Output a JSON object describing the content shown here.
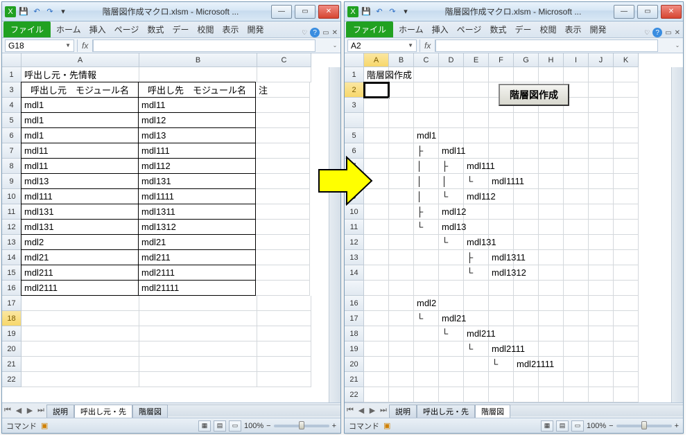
{
  "app_title": "階層図作成マクロ.xlsm - Microsoft ...",
  "ribbon": {
    "file": "ファイル",
    "tabs": [
      "ホーム",
      "挿入",
      "ページ",
      "数式",
      "デー",
      "校閲",
      "表示",
      "開発"
    ]
  },
  "qat": {
    "excel": "X",
    "save": "💾",
    "undo": "↶",
    "redo": "↷",
    "dd": "▾"
  },
  "win_buttons": {
    "min": "—",
    "max": "▭",
    "close": "✕"
  },
  "left": {
    "namebox": "G18",
    "fx": "fx",
    "columns": [
      "A",
      "B",
      "C"
    ],
    "rownums": [
      1,
      3,
      4,
      5,
      6,
      7,
      8,
      9,
      10,
      11,
      12,
      13,
      14,
      15,
      16,
      17,
      18,
      19,
      20,
      21,
      22
    ],
    "title_cell": "呼出し元・先情報",
    "header_src": "呼出し元　モジュール名",
    "header_dst": "呼出し先　モジュール名",
    "note_c": "注",
    "rows": [
      {
        "src": "mdl1",
        "dst": "mdl11"
      },
      {
        "src": "mdl1",
        "dst": "mdl12"
      },
      {
        "src": "mdl1",
        "dst": "mdl13"
      },
      {
        "src": "mdl11",
        "dst": "mdl111"
      },
      {
        "src": "mdl11",
        "dst": "mdl112"
      },
      {
        "src": "mdl13",
        "dst": "mdl131"
      },
      {
        "src": "mdl111",
        "dst": "mdl1111"
      },
      {
        "src": "mdl131",
        "dst": "mdl1311"
      },
      {
        "src": "mdl131",
        "dst": "mdl1312"
      },
      {
        "src": "mdl2",
        "dst": "mdl21"
      },
      {
        "src": "mdl21",
        "dst": "mdl211"
      },
      {
        "src": "mdl211",
        "dst": "mdl2111"
      },
      {
        "src": "mdl2111",
        "dst": "mdl21111"
      }
    ],
    "sheets": [
      "説明",
      "呼出し元・先",
      "階層図"
    ],
    "active_sheet_idx": 1
  },
  "right": {
    "namebox": "A2",
    "fx": "fx",
    "columns": [
      "A",
      "B",
      "C",
      "D",
      "E",
      "F",
      "G",
      "H",
      "I",
      "J",
      "K"
    ],
    "rownums": [
      1,
      2,
      3,
      "",
      5,
      6,
      7,
      8,
      9,
      10,
      11,
      12,
      13,
      14,
      "",
      16,
      17,
      18,
      19,
      20,
      21,
      22
    ],
    "title_cell": "階層図作成",
    "button_label": "階層図作成",
    "tree": [
      {
        "row": 5,
        "col": 3,
        "prefix": "",
        "text": "mdl1"
      },
      {
        "row": 6,
        "col": 3,
        "prefix": "├",
        "text": "mdl11",
        "textcol": 4
      },
      {
        "row": 7,
        "col": 3,
        "prefix": "│",
        "text": "",
        "p2col": 4,
        "p2": "├",
        "textcol": 5,
        "t": "mdl111"
      },
      {
        "row": 8,
        "col": 3,
        "prefix": "│",
        "p2col": 4,
        "p2": "│",
        "p3col": 5,
        "p3": "└",
        "textcol": 6,
        "t": "mdl1111"
      },
      {
        "row": 9,
        "col": 3,
        "prefix": "│",
        "p2col": 4,
        "p2": "└",
        "textcol": 5,
        "t": "mdl112"
      },
      {
        "row": 10,
        "col": 3,
        "prefix": "├",
        "textcol": 4,
        "t": "mdl12"
      },
      {
        "row": 11,
        "col": 3,
        "prefix": "└",
        "textcol": 4,
        "t": "mdl13"
      },
      {
        "row": 12,
        "col": 4,
        "prefix": "└",
        "textcol": 5,
        "t": "mdl131"
      },
      {
        "row": 13,
        "col": 5,
        "prefix": "├",
        "textcol": 6,
        "t": "mdl1311"
      },
      {
        "row": 14,
        "col": 5,
        "prefix": "└",
        "textcol": 6,
        "t": "mdl1312"
      },
      {
        "row": 16,
        "col": 3,
        "prefix": "",
        "text": "mdl2"
      },
      {
        "row": 17,
        "col": 3,
        "prefix": "└",
        "textcol": 4,
        "t": "mdl21"
      },
      {
        "row": 18,
        "col": 4,
        "prefix": "└",
        "textcol": 5,
        "t": "mdl211"
      },
      {
        "row": 19,
        "col": 5,
        "prefix": "└",
        "textcol": 6,
        "t": "mdl2111"
      },
      {
        "row": 20,
        "col": 6,
        "prefix": "└",
        "textcol": 7,
        "t": "mdl21111"
      }
    ],
    "sheets": [
      "説明",
      "呼出し元・先",
      "階層図"
    ],
    "active_sheet_idx": 2
  },
  "status": {
    "mode": "コマンド",
    "zoom": "100%",
    "zoom_minus": "−",
    "zoom_plus": "+"
  }
}
